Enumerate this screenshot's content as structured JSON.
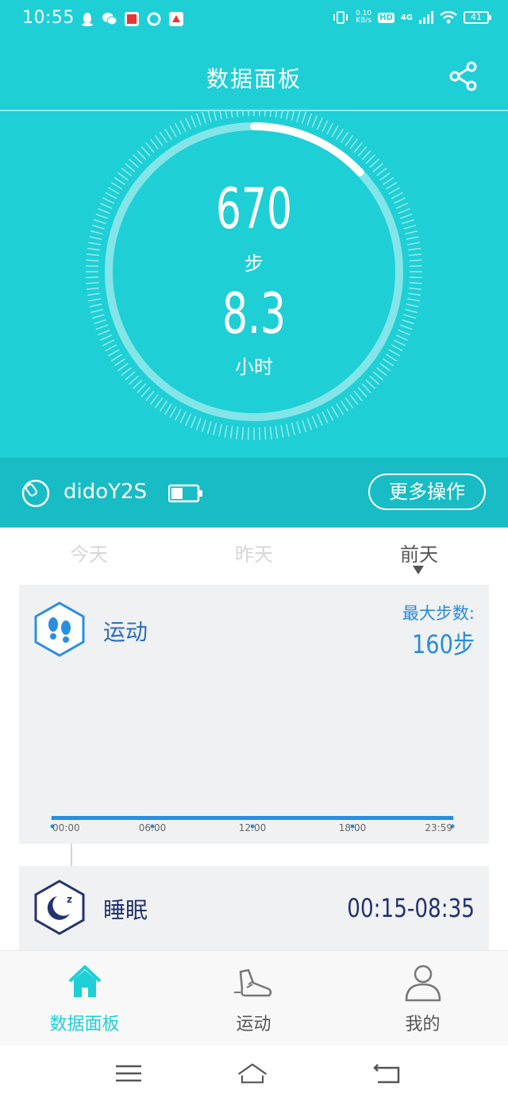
{
  "status_bar": {
    "time": "10:55",
    "net_speed_value": "0.10",
    "net_speed_unit": "KB/s",
    "hd": "HD",
    "network": "4G",
    "battery": "41"
  },
  "header": {
    "title": "数据面板",
    "share_icon": "share-icon"
  },
  "summary": {
    "steps_value": "670",
    "steps_unit": "步",
    "hours_value": "8.3",
    "hours_unit": "小时",
    "ring_progress_fraction": 0.13
  },
  "device": {
    "name": "didoY2S",
    "battery_level_fraction": 0.45,
    "more_label": "更多操作"
  },
  "day_tabs": [
    {
      "label": "今天",
      "active": false
    },
    {
      "label": "昨天",
      "active": false
    },
    {
      "label": "前天",
      "active": true
    }
  ],
  "activity": {
    "title": "运动",
    "max_label": "最大步数:",
    "max_value": "160步",
    "icon": "footprints-icon"
  },
  "chart_data": {
    "type": "bar",
    "x_ticks": [
      "00:00",
      "06:00",
      "12:00",
      "18:00",
      "23:59"
    ],
    "bar_color": "#2a8fe0",
    "slots_per_hour": 2,
    "values": [
      3,
      3,
      3,
      3,
      3,
      3,
      3,
      3,
      3,
      3,
      3,
      3,
      3,
      3,
      3,
      3,
      3,
      3,
      3,
      3,
      3,
      3,
      3,
      3,
      3,
      3,
      3,
      3,
      3,
      3,
      3,
      3,
      3,
      3,
      3,
      3,
      3,
      3,
      3,
      3,
      3,
      3,
      3,
      3,
      3,
      3,
      3,
      3,
      3,
      3,
      3,
      3,
      3,
      3,
      3,
      3,
      3,
      3,
      3,
      3,
      3,
      3,
      3,
      3,
      3,
      3,
      3,
      3,
      3,
      3,
      3,
      3,
      3,
      3,
      3,
      3,
      3,
      3,
      3,
      3,
      3,
      3,
      3,
      3,
      3,
      3,
      3,
      3,
      3,
      3,
      3,
      3,
      3,
      3,
      3,
      3,
      3,
      3,
      3,
      3,
      3,
      3,
      3,
      3,
      3,
      3,
      3,
      3,
      3,
      3,
      3,
      3,
      3,
      3,
      3,
      3,
      3,
      3,
      3,
      3,
      3,
      3,
      3,
      3,
      3,
      3,
      3,
      3,
      3,
      3,
      3,
      3,
      3,
      3,
      3,
      3,
      3,
      3,
      3,
      3,
      3,
      3,
      3,
      3,
      3,
      3,
      3,
      3,
      3,
      3,
      3,
      3,
      3,
      3,
      3,
      3,
      3,
      3,
      3,
      3,
      3,
      3,
      3,
      3,
      3,
      3,
      3,
      3,
      3,
      3,
      3,
      3,
      3,
      3,
      3,
      3,
      3,
      3,
      3,
      3,
      3,
      3,
      3,
      3,
      3,
      3,
      3,
      3,
      3,
      3
    ],
    "ylim": [
      0,
      160
    ]
  },
  "sleep": {
    "title": "睡眠",
    "range": "00:15-08:35",
    "icon": "moon-sleep-icon"
  },
  "bottom_nav": [
    {
      "label": "数据面板",
      "icon": "home-icon",
      "active": true
    },
    {
      "label": "运动",
      "icon": "running-shoe-icon",
      "active": false
    },
    {
      "label": "我的",
      "icon": "person-icon",
      "active": false
    }
  ],
  "colors": {
    "primary": "#1ecfd6",
    "device_bar": "#18bcc4",
    "chart_blue": "#2a8fe0",
    "sleep_navy": "#24336e"
  }
}
